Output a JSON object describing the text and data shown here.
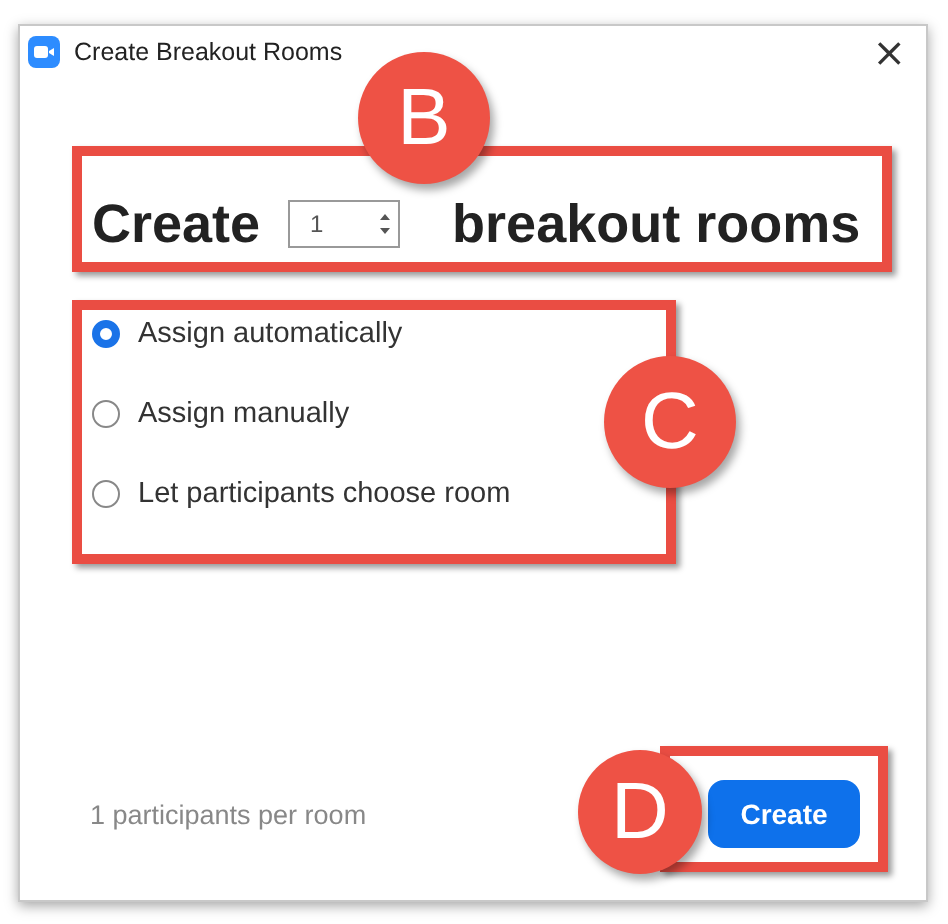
{
  "window": {
    "title": "Create Breakout Rooms",
    "close": "×"
  },
  "heading": {
    "prefix": "Create",
    "count": "1",
    "suffix": "breakout rooms"
  },
  "options": [
    {
      "label": "Assign automatically",
      "selected": true
    },
    {
      "label": "Assign manually",
      "selected": false
    },
    {
      "label": "Let participants choose room",
      "selected": false
    }
  ],
  "footer": {
    "note": "1 participants per room",
    "button": "Create"
  },
  "annotations": [
    {
      "label": "B"
    },
    {
      "label": "C"
    },
    {
      "label": "D"
    }
  ]
}
